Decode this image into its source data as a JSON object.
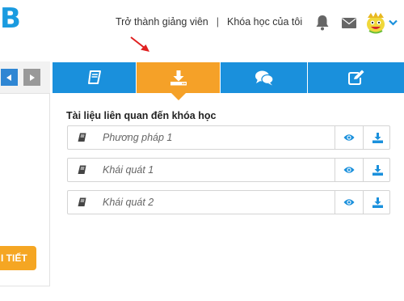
{
  "header": {
    "logo_letter": "B",
    "nav": [
      {
        "label": "Trở thành giảng viên"
      },
      {
        "label": "Khóa học của tôi"
      }
    ],
    "nav_separator": "|"
  },
  "left_panel": {
    "detail_button_label": "I TIẾT"
  },
  "tabs": [
    {
      "icon": "book-icon",
      "active": false
    },
    {
      "icon": "download-icon",
      "active": true
    },
    {
      "icon": "chat-bubbles-icon",
      "active": false
    },
    {
      "icon": "edit-icon",
      "active": false
    }
  ],
  "documents": {
    "title": "Tài liệu liên quan đến khóa học",
    "items": [
      {
        "label": "Phương pháp 1"
      },
      {
        "label": "Khái quát 1"
      },
      {
        "label": "Khái quát 2"
      }
    ]
  },
  "colors": {
    "brand_blue": "#1a90dc",
    "active_orange": "#f5a128",
    "pointer_red": "#e02020"
  }
}
